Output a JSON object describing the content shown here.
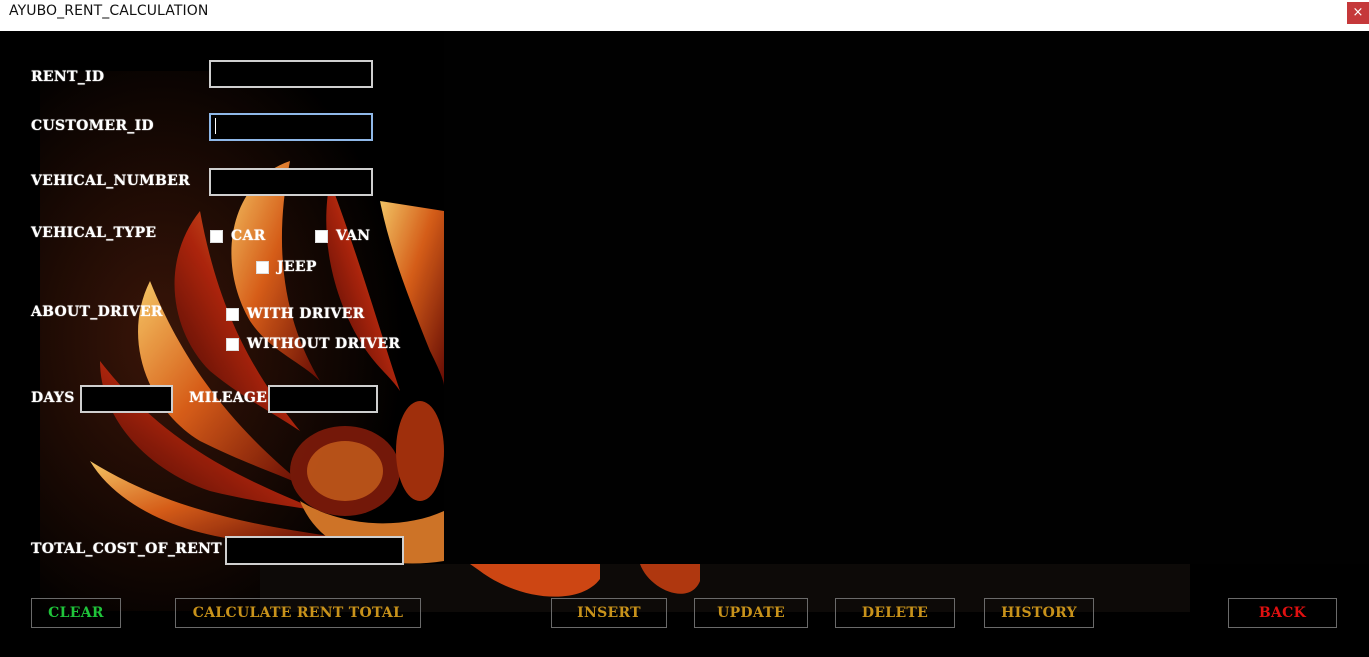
{
  "window": {
    "title": "AYUBO_RENT_CALCULATION",
    "close_symbol": "×"
  },
  "form": {
    "rent_id_label": "RENT_ID",
    "rent_id_value": "",
    "customer_id_label": "CUSTOMER_ID",
    "customer_id_value": "",
    "vehicle_number_label": "VEHICAL_NUMBER",
    "vehicle_number_value": "",
    "vehicle_type_label": "VEHICAL_TYPE",
    "vehicle_types": [
      "CAR",
      "VAN",
      "JEEP"
    ],
    "about_driver_label": "ABOUT_DRIVER",
    "driver_options": [
      "WITH DRIVER",
      "WITHOUT DRIVER"
    ],
    "days_label": "DAYS",
    "days_value": "",
    "mileage_label": "MILEAGE",
    "mileage_value": "",
    "total_cost_label": "TOTAL_COST_OF_RENT",
    "total_cost_value": ""
  },
  "buttons": {
    "clear": "CLEAR",
    "calculate": "CALCULATE RENT TOTAL",
    "insert": "INSERT",
    "update": "UPDATE",
    "delete": "DELETE",
    "history": "HISTORY",
    "back": "BACK"
  },
  "colors": {
    "clear": "#1fc43a",
    "gold": "#c8921a",
    "back": "#e01010",
    "focus_border": "#8fb8e8"
  }
}
